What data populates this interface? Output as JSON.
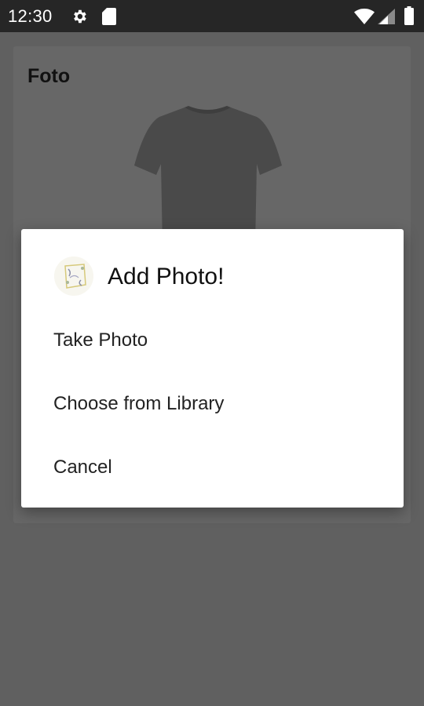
{
  "status_bar": {
    "time": "12:30",
    "icons": [
      "gear-icon",
      "sd-card-icon",
      "wifi-icon",
      "signal-icon",
      "battery-icon"
    ]
  },
  "card": {
    "title": "Foto",
    "image": "tshirt-image"
  },
  "dialog": {
    "title": "Add Photo!",
    "logo": "app-logo-icon",
    "options": [
      {
        "label": "Take Photo"
      },
      {
        "label": "Choose from Library"
      },
      {
        "label": "Cancel"
      }
    ]
  },
  "colors": {
    "scrim": "#606060",
    "status_bar": "#262626",
    "dialog_bg": "#ffffff",
    "tshirt": "#4a4a4a"
  }
}
